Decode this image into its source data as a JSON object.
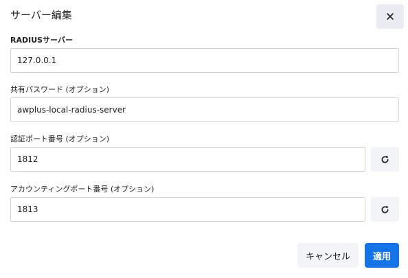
{
  "dialog": {
    "title": "サーバー編集",
    "close_icon": "close-icon"
  },
  "fields": {
    "radius_server": {
      "label": "RADIUSサーバー",
      "value": "127.0.0.1"
    },
    "shared_password": {
      "label": "共有パスワード (オプション)",
      "value": "awplus-local-radius-server"
    },
    "auth_port": {
      "label": "認証ポート番号 (オプション)",
      "value": "1812",
      "reset_icon": "refresh-icon"
    },
    "accounting_port": {
      "label": "アカウンティングポート番号 (オプション)",
      "value": "1813",
      "reset_icon": "refresh-icon"
    }
  },
  "footer": {
    "cancel_label": "キャンセル",
    "apply_label": "適用"
  },
  "colors": {
    "accent": "#1473e6",
    "button_bg": "#f2f4f7",
    "border": "#d0d4da"
  }
}
